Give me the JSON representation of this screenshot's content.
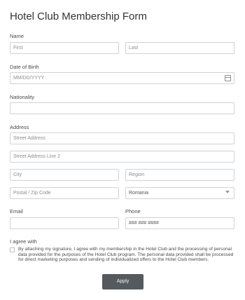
{
  "form": {
    "title": "Hotel Club Membership Form",
    "name": {
      "label": "Name",
      "first_placeholder": "First",
      "last_placeholder": "Last"
    },
    "dob": {
      "label": "Date of Birth",
      "placeholder": "MM/DD/YYYY",
      "icon": "calendar-icon"
    },
    "nationality": {
      "label": "Nationality",
      "value": ""
    },
    "address": {
      "label": "Address",
      "street_placeholder": "Street Address",
      "street2_placeholder": "Street Address Line 2",
      "city_placeholder": "City",
      "region_placeholder": "Region",
      "postal_placeholder": "Postal / Zip Code",
      "country_selected": "Romania"
    },
    "email": {
      "label": "Email",
      "value": ""
    },
    "phone": {
      "label": "Phone",
      "placeholder": "### ### ####"
    },
    "agreement": {
      "label": "I agree with",
      "text": "By attaching my signature, I agree with my membership in the Hotel Club and the processing of personal data provided for the purposes of the Hotel Club program. The personal data provided shall be processed for direct marketing purposes and sending of individualized offers to the Hotel Club members.",
      "checked": false
    },
    "submit_label": "Apply"
  },
  "colors": {
    "button_bg": "#555a5e",
    "field_border": "#cfd3d8",
    "text": "#3d3d3d"
  }
}
